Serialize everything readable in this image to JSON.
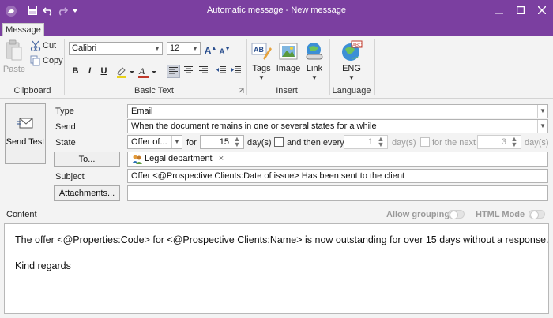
{
  "window": {
    "title": "Automatic message - New message",
    "buttons": [
      "minimize",
      "maximize",
      "close"
    ]
  },
  "quick_access": {
    "icons": [
      "app-logo-icon",
      "save-icon",
      "undo-icon",
      "redo-icon",
      "customize-icon"
    ]
  },
  "tabs": {
    "message": "Message"
  },
  "ribbon": {
    "clipboard": {
      "label": "Clipboard",
      "paste": "Paste",
      "cut": "Cut",
      "copy": "Copy"
    },
    "basic_text": {
      "label": "Basic Text",
      "font": "Calibri",
      "size": "12",
      "grow": "A",
      "shrink": "A",
      "bold": "B",
      "italic": "I",
      "underline": "U"
    },
    "insert": {
      "label": "Insert",
      "tags": "Tags",
      "image": "Image",
      "link": "Link"
    },
    "language": {
      "label": "Language",
      "lang": "ENG"
    }
  },
  "form": {
    "send_test": "Send Test",
    "type_label": "Type",
    "type_value": "Email",
    "send_label": "Send",
    "send_value": "When the document remains in one or several states for a while",
    "state_label": "State",
    "state_value": "Offer of...",
    "for_label": "for",
    "for_value": "15",
    "days_label": "day(s)",
    "then_every_label": "and then every",
    "then_every_value": "1",
    "days_label_2": "day(s)",
    "for_next_label": "for the next",
    "for_next_value": "3",
    "days_label_3": "day(s)",
    "to_button": "To...",
    "recipient": "Legal department",
    "recipient_remove": "×",
    "subject_label": "Subject",
    "subject_value": "Offer <@Prospective Clients:Date of issue> Has been sent to the client",
    "attachments_button": "Attachments...",
    "content_label": "Content",
    "allow_grouping": "Allow grouping",
    "html_mode": "HTML Mode"
  },
  "body": {
    "line1": "The offer <@Properties:Code> for <@Prospective Clients:Name> is now outstanding for over 15 days without a response.",
    "line2": "Kind regards"
  },
  "colors": {
    "titlebar": "#7b3fa0",
    "ribbon_bg": "#f3f3f3"
  }
}
